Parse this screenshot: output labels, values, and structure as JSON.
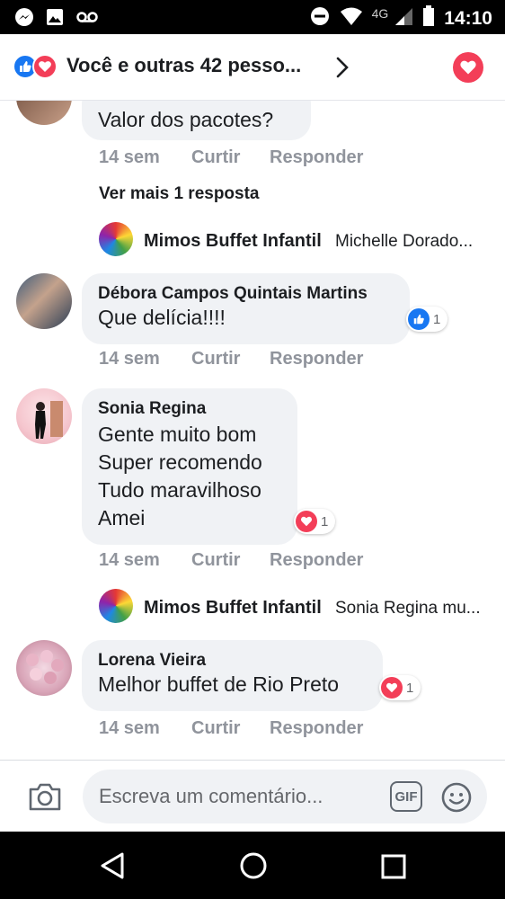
{
  "status_bar": {
    "network": "4G",
    "time": "14:10",
    "icons": [
      "messenger-icon",
      "image-icon",
      "voicemail-icon",
      "do-not-disturb-icon",
      "wifi-icon",
      "signal-icon",
      "battery-icon"
    ]
  },
  "header": {
    "title": "Você e outras 42 pesso...",
    "reactions": [
      "like",
      "love"
    ]
  },
  "comments": [
    {
      "author": "",
      "text": "Valor dos pacotes?",
      "time": "14 sem",
      "like_label": "Curtir",
      "reply_label": "Responder",
      "more_replies": "Ver mais 1 resposta",
      "reply": {
        "author": "Mimos Buffet Infantil",
        "text": "Michelle Dorado..."
      }
    },
    {
      "author": "Débora Campos Quintais Martins",
      "text_lines": [
        "Que delícia!!!!"
      ],
      "time": "14 sem",
      "like_label": "Curtir",
      "reply_label": "Responder",
      "reaction": {
        "type": "like",
        "count": "1"
      }
    },
    {
      "author": "Sonia Regina",
      "text_lines": [
        "Gente muito bom",
        "Super recomendo",
        "Tudo maravilhoso",
        "Amei"
      ],
      "time": "14 sem",
      "like_label": "Curtir",
      "reply_label": "Responder",
      "reaction": {
        "type": "love",
        "count": "1"
      },
      "reply": {
        "author": "Mimos Buffet Infantil",
        "text": "Sonia Regina mu..."
      }
    },
    {
      "author": "Lorena Vieira",
      "text_lines": [
        "Melhor buffet de Rio Preto"
      ],
      "time": "14 sem",
      "like_label": "Curtir",
      "reply_label": "Responder",
      "reaction": {
        "type": "love",
        "count": "1"
      }
    }
  ],
  "composer": {
    "placeholder": "Escreva um comentário...",
    "gif_label": "GIF"
  },
  "colors": {
    "like_blue": "#1877f2",
    "love_red": "#f33e58",
    "bubble_bg": "#f0f2f5",
    "meta_gray": "#90949c"
  }
}
